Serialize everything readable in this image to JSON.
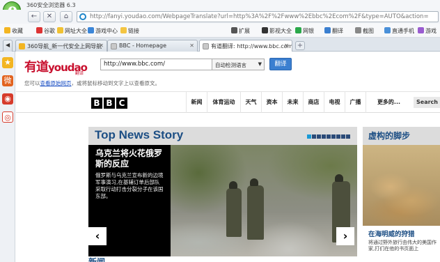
{
  "app": {
    "title": "360安全浏览器 6.3"
  },
  "address": {
    "url": "http://fanyi.youdao.com/WebpageTranslate?url=http%3A%2F%2Fwww%2Ebbc%2Ecom%2F&type=AUTO&action="
  },
  "bookmarks": [
    "收藏",
    "谷歌",
    "网址大全",
    "游戏中心",
    "链接",
    "扩展",
    "影视大全",
    "网银",
    "翻译",
    "截图",
    "直通手机",
    "游戏"
  ],
  "tabs": [
    {
      "label": "360导航_新一代安全上网导航"
    },
    {
      "label": "BBC - Homepage"
    },
    {
      "label": "有道翻译: http://www.bbc.com/"
    }
  ],
  "youdao": {
    "logo_cn": "有道",
    "logo_en": "youdao",
    "logo_sub": "翻译",
    "url_value": "http://www.bbc.com/",
    "lang_select": "自动检测语言",
    "translate_button": "翻译",
    "tip_prefix": "您可以",
    "tip_link": "查看原始网页",
    "tip_suffix": "，或将鼠标移动到文字上以查看原文。"
  },
  "bbc": {
    "logo": [
      "B",
      "B",
      "C"
    ],
    "nav": [
      "新闻",
      "体育运动",
      "天气",
      "资本",
      "未来",
      "商店",
      "电视",
      "广播",
      "更多的..."
    ],
    "search": "Search"
  },
  "main": {
    "section_title": "Top News Story",
    "story_headline": "乌克兰将火花俄罗斯的反应",
    "story_summary": "俄罗斯与乌克兰宣布新的边境军事演习,在基辅订单后部队采取行动打击分裂分子在该国东部。",
    "prev_arrow": "‹",
    "next_arrow": "›",
    "side_title": "虚构的脚步",
    "side_caption": "在海明威的狩猎",
    "side_desc": "将通过野外旅行由伟大的美国作家,打们在他的书页面上",
    "bottom_heading": "新闻"
  },
  "sidebar_icons": [
    "star-icon",
    "weibo-icon",
    "watch-icon",
    "target-icon"
  ]
}
